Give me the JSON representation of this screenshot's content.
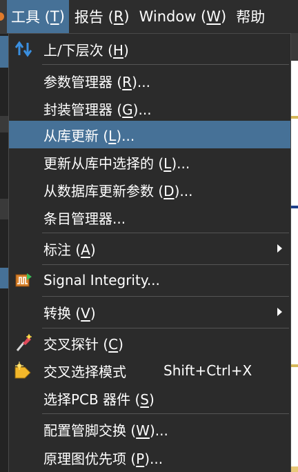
{
  "menubar": {
    "items": [
      {
        "text": "工具 (",
        "key": "T",
        "tail": ")"
      },
      {
        "text": "报告 (",
        "key": "R",
        "tail": ")"
      },
      {
        "text": "Window (",
        "key": "W",
        "tail": ")"
      },
      {
        "text": "帮助",
        "key": "",
        "tail": ""
      }
    ]
  },
  "menu": {
    "items": [
      {
        "pre": "上/下层次 (",
        "key": "H",
        "post": ")",
        "icon": "up-down-arrows-icon"
      },
      {
        "pre": "参数管理器 (",
        "key": "R",
        "post": ")..."
      },
      {
        "pre": "封装管理器 (",
        "key": "G",
        "post": ")..."
      },
      {
        "pre": "从库更新 (",
        "key": "L",
        "post": ")..."
      },
      {
        "pre": "更新从库中选择的 (",
        "key": "L",
        "post": ")..."
      },
      {
        "pre": "从数据库更新参数 (",
        "key": "D",
        "post": ")..."
      },
      {
        "pre": "条目管理器...",
        "key": "",
        "post": ""
      },
      {
        "pre": "标注 (",
        "key": "A",
        "post": ")"
      },
      {
        "pre": "Signal Integrity...",
        "key": "",
        "post": "",
        "icon": "signal-integrity-icon"
      },
      {
        "pre": "转换 (",
        "key": "V",
        "post": ")"
      },
      {
        "pre": "交叉探针 (",
        "key": "C",
        "post": ")",
        "icon": "cross-probe-icon"
      },
      {
        "pre": "交叉选择模式",
        "key": "",
        "post": "",
        "shortcut": "Shift+Ctrl+X",
        "icon": "cross-select-icon"
      },
      {
        "pre": "选择PCB 器件 (",
        "key": "S",
        "post": ")"
      },
      {
        "pre": "配置管脚交换 (",
        "key": "W",
        "post": ")..."
      },
      {
        "pre": "原理图优先项 (",
        "key": "P",
        "post": ")..."
      }
    ]
  },
  "colors": {
    "menu_bg": "#2b2b2b",
    "highlight": "#467197",
    "text": "#ffffff",
    "separator": "#555555"
  }
}
